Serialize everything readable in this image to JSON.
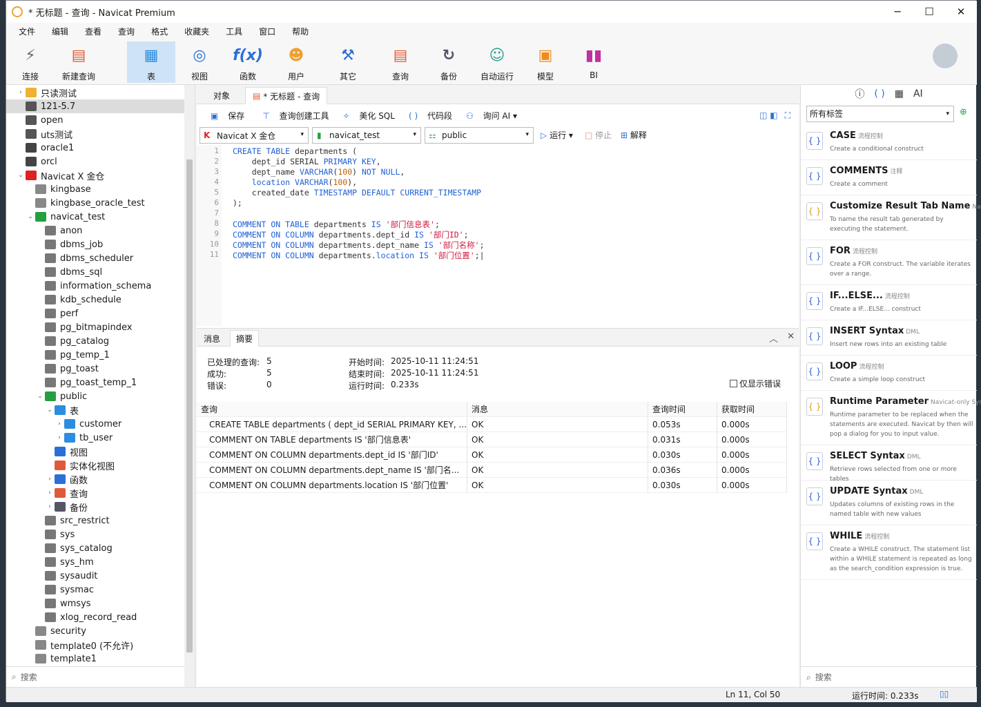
{
  "window": {
    "title": "* 无标题 - 查询 - Navicat Premium"
  },
  "menu": [
    "文件",
    "编辑",
    "查看",
    "查询",
    "格式",
    "收藏夹",
    "工具",
    "窗口",
    "帮助"
  ],
  "toolbar": {
    "connect": "连接",
    "new_query": "新建查询",
    "table": "表",
    "view": "视图",
    "function": "函数",
    "user": "用户",
    "other": "其它",
    "query": "查询",
    "backup": "备份",
    "automation": "自动运行",
    "model": "模型",
    "bi": "BI"
  },
  "tree": [
    {
      "label": "只读测试",
      "depth": 0,
      "arrow": ">",
      "icon": "folder-icon"
    },
    {
      "label": "121-5.7",
      "depth": 0,
      "arrow": "",
      "icon": "mysql-icon",
      "selected": true
    },
    {
      "label": "open",
      "depth": 0,
      "arrow": "",
      "icon": "mysql-icon"
    },
    {
      "label": "uts测试",
      "depth": 0,
      "arrow": "",
      "icon": "mysql-icon"
    },
    {
      "label": "oracle1",
      "depth": 0,
      "arrow": "",
      "icon": "oracle-icon"
    },
    {
      "label": "orcl",
      "depth": 0,
      "arrow": "",
      "icon": "oracle-icon"
    },
    {
      "label": "Navicat X 金仓",
      "depth": 0,
      "arrow": "v",
      "icon": "kingbase-icon"
    },
    {
      "label": "kingbase",
      "depth": 1,
      "arrow": "",
      "icon": "database-icon"
    },
    {
      "label": "kingbase_oracle_test",
      "depth": 1,
      "arrow": "",
      "icon": "database-icon"
    },
    {
      "label": "navicat_test",
      "depth": 1,
      "arrow": "v",
      "icon": "database-open-icon"
    },
    {
      "label": "anon",
      "depth": 2,
      "arrow": "",
      "icon": "schema-icon"
    },
    {
      "label": "dbms_job",
      "depth": 2,
      "arrow": "",
      "icon": "schema-icon"
    },
    {
      "label": "dbms_scheduler",
      "depth": 2,
      "arrow": "",
      "icon": "schema-icon"
    },
    {
      "label": "dbms_sql",
      "depth": 2,
      "arrow": "",
      "icon": "schema-icon"
    },
    {
      "label": "information_schema",
      "depth": 2,
      "arrow": "",
      "icon": "schema-icon"
    },
    {
      "label": "kdb_schedule",
      "depth": 2,
      "arrow": "",
      "icon": "schema-icon"
    },
    {
      "label": "perf",
      "depth": 2,
      "arrow": "",
      "icon": "schema-icon"
    },
    {
      "label": "pg_bitmapindex",
      "depth": 2,
      "arrow": "",
      "icon": "schema-icon"
    },
    {
      "label": "pg_catalog",
      "depth": 2,
      "arrow": "",
      "icon": "schema-icon"
    },
    {
      "label": "pg_temp_1",
      "depth": 2,
      "arrow": "",
      "icon": "schema-icon"
    },
    {
      "label": "pg_toast",
      "depth": 2,
      "arrow": "",
      "icon": "schema-icon"
    },
    {
      "label": "pg_toast_temp_1",
      "depth": 2,
      "arrow": "",
      "icon": "schema-icon"
    },
    {
      "label": "public",
      "depth": 2,
      "arrow": "v",
      "icon": "schema-open-icon"
    },
    {
      "label": "表",
      "depth": 3,
      "arrow": "v",
      "icon": "table-icon"
    },
    {
      "label": "customer",
      "depth": 4,
      "arrow": ">",
      "icon": "table-icon"
    },
    {
      "label": "tb_user",
      "depth": 4,
      "arrow": ">",
      "icon": "table-icon"
    },
    {
      "label": "视图",
      "depth": 3,
      "arrow": "",
      "icon": "view-icon"
    },
    {
      "label": "实体化视图",
      "depth": 3,
      "arrow": "",
      "icon": "materialized-view-icon"
    },
    {
      "label": "函数",
      "depth": 3,
      "arrow": ">",
      "icon": "function-icon"
    },
    {
      "label": "查询",
      "depth": 3,
      "arrow": ">",
      "icon": "query-icon"
    },
    {
      "label": "备份",
      "depth": 3,
      "arrow": ">",
      "icon": "backup-icon"
    },
    {
      "label": "src_restrict",
      "depth": 2,
      "arrow": "",
      "icon": "schema-icon"
    },
    {
      "label": "sys",
      "depth": 2,
      "arrow": "",
      "icon": "schema-icon"
    },
    {
      "label": "sys_catalog",
      "depth": 2,
      "arrow": "",
      "icon": "schema-icon"
    },
    {
      "label": "sys_hm",
      "depth": 2,
      "arrow": "",
      "icon": "schema-icon"
    },
    {
      "label": "sysaudit",
      "depth": 2,
      "arrow": "",
      "icon": "schema-icon"
    },
    {
      "label": "sysmac",
      "depth": 2,
      "arrow": "",
      "icon": "schema-icon"
    },
    {
      "label": "wmsys",
      "depth": 2,
      "arrow": "",
      "icon": "schema-icon"
    },
    {
      "label": "xlog_record_read",
      "depth": 2,
      "arrow": "",
      "icon": "schema-icon"
    },
    {
      "label": "security",
      "depth": 1,
      "arrow": "",
      "icon": "database-icon"
    },
    {
      "label": "template0 (不允许)",
      "depth": 1,
      "arrow": "",
      "icon": "database-icon"
    },
    {
      "label": "template1",
      "depth": 1,
      "arrow": "",
      "icon": "database-icon"
    }
  ],
  "left_search_placeholder": "搜索",
  "tabs": {
    "objects": "对象",
    "query": "* 无标题 - 查询"
  },
  "query_toolbar": {
    "save": "保存",
    "builder": "查询创建工具",
    "beautify": "美化 SQL",
    "snippet": "代码段",
    "ask_ai": "询问 AI"
  },
  "combos": {
    "connection": "Navicat X 金仓",
    "database": "navicat_test",
    "schema": "public"
  },
  "run": {
    "run": "运行",
    "stop": "停止",
    "explain": "解释"
  },
  "result_tabs": {
    "message": "消息",
    "summary": "摘要"
  },
  "summary": {
    "processed_label": "已处理的查询:",
    "processed": "5",
    "success_label": "成功:",
    "success": "5",
    "error_label": "错误:",
    "error": "0",
    "start_label": "开始时间:",
    "start": "2025-10-11 11:24:51",
    "end_label": "结束时间:",
    "end": "2025-10-11 11:24:51",
    "elapsed_label": "运行时间:",
    "elapsed": "0.233s",
    "only_errors": "仅显示错误"
  },
  "grid": {
    "headers": [
      "查询",
      "消息",
      "查询时间",
      "获取时间"
    ],
    "rows": [
      [
        "CREATE TABLE departments ( dept_id SERIAL PRIMARY KEY, ...",
        "OK",
        "0.053s",
        "0.000s"
      ],
      [
        "COMMENT ON TABLE departments IS '部门信息表'",
        "OK",
        "0.031s",
        "0.000s"
      ],
      [
        "COMMENT ON COLUMN departments.dept_id IS '部门ID'",
        "OK",
        "0.030s",
        "0.000s"
      ],
      [
        "COMMENT ON COLUMN departments.dept_name IS '部门名...",
        "OK",
        "0.036s",
        "0.000s"
      ],
      [
        "COMMENT ON COLUMN departments.location IS '部门位置'",
        "OK",
        "0.030s",
        "0.000s"
      ]
    ]
  },
  "snippets": {
    "filter": "所有标签",
    "items": [
      {
        "name": "CASE",
        "tag": "流程控制",
        "desc": "Create a conditional construct"
      },
      {
        "name": "COMMENTS",
        "tag": "注释",
        "desc": "Create a comment"
      },
      {
        "name": "Customize Result Tab Name",
        "tag": "Nav",
        "desc": "To name the result tab generated by executing the statement."
      },
      {
        "name": "FOR",
        "tag": "流程控制",
        "desc": "Create a FOR construct. The variable iterates over a range."
      },
      {
        "name": "IF...ELSE...",
        "tag": "流程控制",
        "desc": "Create a IF...ELSE... construct"
      },
      {
        "name": "INSERT Syntax",
        "tag": "DML",
        "desc": "Insert new rows into an existing table"
      },
      {
        "name": "LOOP",
        "tag": "流程控制",
        "desc": "Create a simple loop construct"
      },
      {
        "name": "Runtime Parameter",
        "tag": "Navicat-only Synt",
        "desc": "Runtime parameter to be replaced when the statements are executed. Navicat by then will pop a dialog for you to input value."
      },
      {
        "name": "SELECT Syntax",
        "tag": "DML",
        "desc": "Retrieve rows selected from one or more tables"
      },
      {
        "name": "UPDATE Syntax",
        "tag": "DML",
        "desc": "Updates columns of existing rows in the named table with new values"
      },
      {
        "name": "WHILE",
        "tag": "流程控制",
        "desc": "Create a WHILE construct. The statement list within a WHILE statement is repeated as long as the search_condition expression is true."
      }
    ],
    "search_placeholder": "搜索"
  },
  "status": {
    "position": "Ln 11, Col 50",
    "elapsed": "运行时间: 0.233s"
  }
}
